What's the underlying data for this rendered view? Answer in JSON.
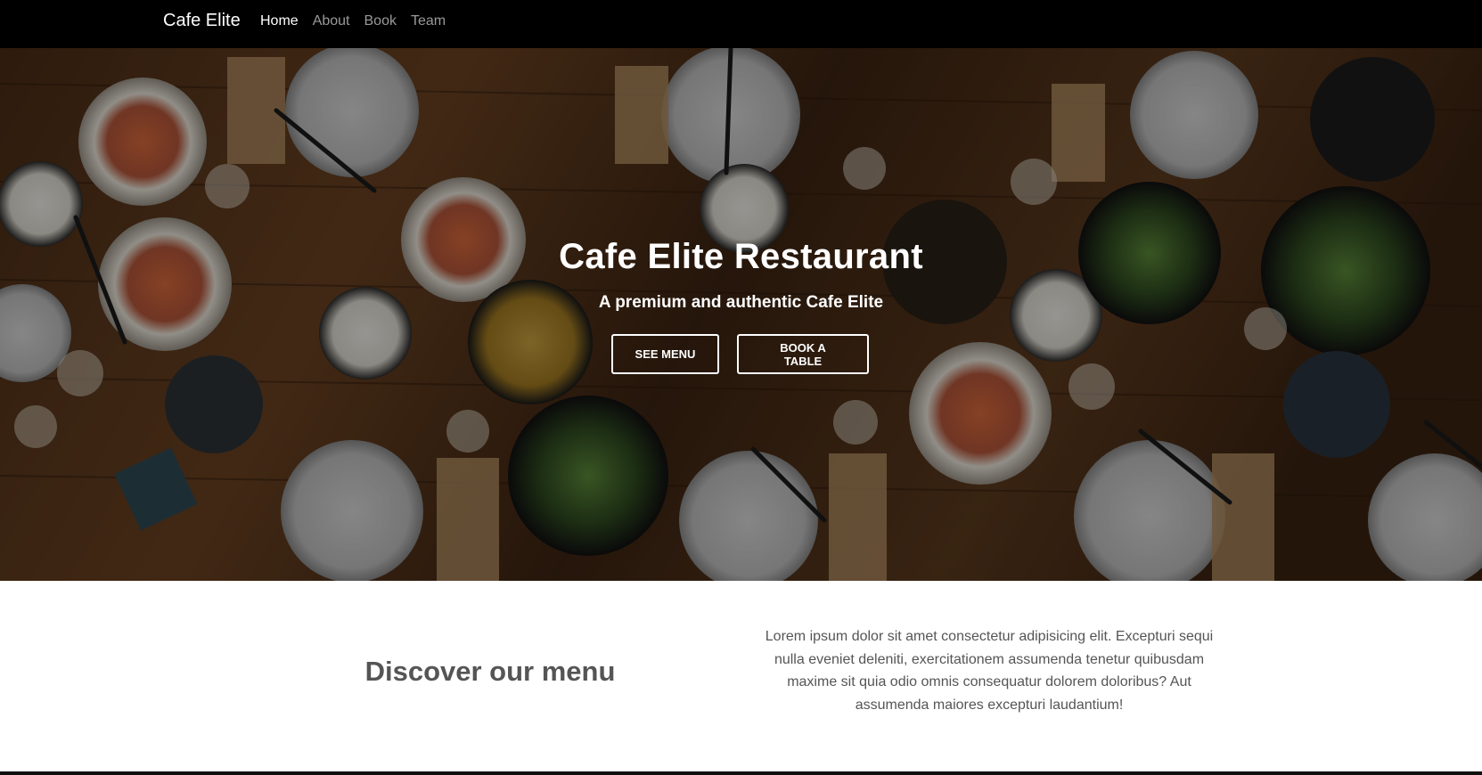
{
  "navbar": {
    "brand": "Cafe Elite",
    "links": [
      "Home",
      "About",
      "Book",
      "Team"
    ],
    "active_index": 0
  },
  "hero": {
    "title": "Cafe Elite Restaurant",
    "subtitle": "A premium and authentic Cafe Elite",
    "buttons": [
      "SEE MENU",
      "BOOK A TABLE"
    ]
  },
  "discover": {
    "title": "Discover our menu",
    "text": "Lorem ipsum dolor sit amet consectetur adipisicing elit. Excepturi sequi nulla eveniet deleniti, exercitationem assumenda tenetur quibusdam maxime sit quia odio omnis consequatur dolorem doloribus? Aut assumenda maiores excepturi laudantium!"
  },
  "colors": {
    "navbar_bg": "#000000",
    "text_muted": "#555555",
    "button_border": "#ffffff"
  }
}
